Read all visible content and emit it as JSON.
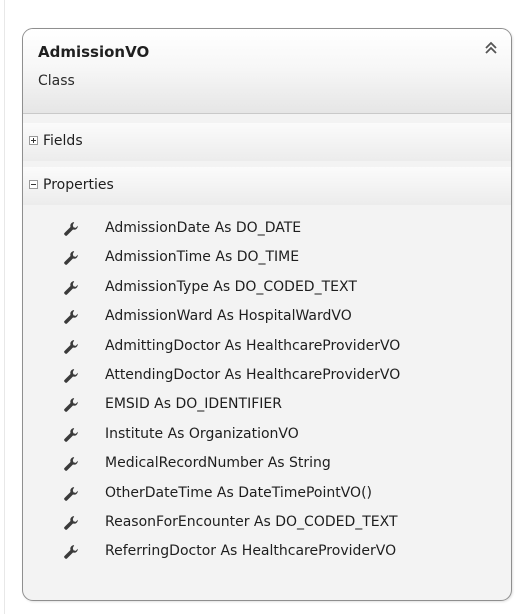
{
  "class_box": {
    "name": "AdmissionVO",
    "kind": "Class",
    "collapse_icon": "double-chevron-up-icon"
  },
  "sections": {
    "fields": {
      "label": "Fields",
      "expanded": false,
      "toggle_icon": "expand-plus-icon"
    },
    "properties": {
      "label": "Properties",
      "expanded": true,
      "toggle_icon": "collapse-minus-icon"
    }
  },
  "properties": [
    {
      "text": "AdmissionDate As DO_DATE",
      "icon": "wrench-icon"
    },
    {
      "text": "AdmissionTime As DO_TIME",
      "icon": "wrench-icon"
    },
    {
      "text": "AdmissionType As DO_CODED_TEXT",
      "icon": "wrench-icon"
    },
    {
      "text": "AdmissionWard As HospitalWardVO",
      "icon": "wrench-icon"
    },
    {
      "text": "AdmittingDoctor As HealthcareProviderVO",
      "icon": "wrench-icon"
    },
    {
      "text": "AttendingDoctor As HealthcareProviderVO",
      "icon": "wrench-icon"
    },
    {
      "text": "EMSID As DO_IDENTIFIER",
      "icon": "wrench-icon"
    },
    {
      "text": "Institute As OrganizationVO",
      "icon": "wrench-icon"
    },
    {
      "text": "MedicalRecordNumber As String",
      "icon": "wrench-icon"
    },
    {
      "text": "OtherDateTime As DateTimePointVO()",
      "icon": "wrench-icon"
    },
    {
      "text": "ReasonForEncounter As DO_CODED_TEXT",
      "icon": "wrench-icon"
    },
    {
      "text": "ReferringDoctor As HealthcareProviderVO",
      "icon": "wrench-icon"
    }
  ]
}
